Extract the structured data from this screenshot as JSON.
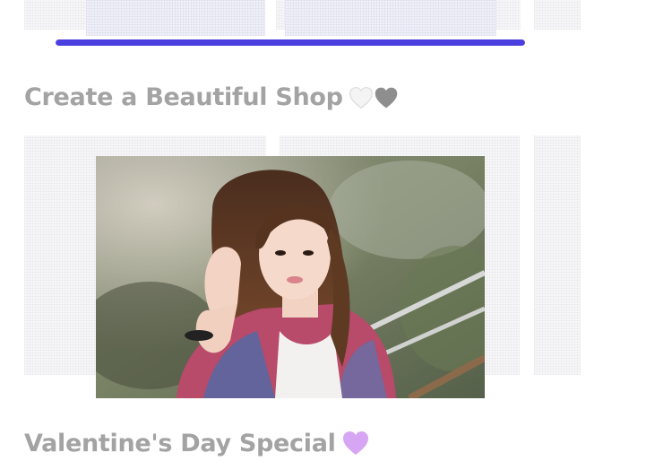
{
  "slider_progress": 1.0,
  "sections": [
    {
      "title": "Create a Beautiful Shop",
      "emoji": [
        "white-heart-icon",
        "grey-heart-icon"
      ]
    },
    {
      "title": "Valentine's Day Special",
      "emoji": [
        "purple-heart-icon"
      ]
    }
  ],
  "colors": {
    "accent": "#4b3fe0",
    "heading": "#a3a3a3",
    "white_heart": "#f4f4f4",
    "grey_heart": "#8e8e8e",
    "purple_heart": "#d6a5f3"
  }
}
